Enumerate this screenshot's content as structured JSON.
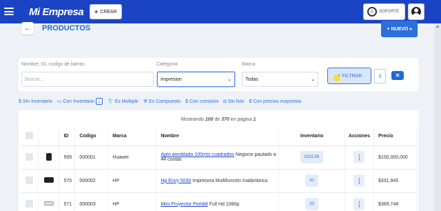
{
  "topbar": {
    "logo": "Mi Empresa",
    "crear_label": "CREAR",
    "soporte_label": "SOPORTE",
    "colors": {
      "bar": "#1a44c4",
      "accent": "#2a6fdb"
    }
  },
  "page": {
    "title": "PRODUCTOS",
    "nuevo_label": "NUEVO"
  },
  "filters": {
    "search_label": "Nombre, ID, codigo de barras",
    "search_placeholder": "Buscar...",
    "categoria_label": "Categoria",
    "categoria_value": "Impresion",
    "marca_label": "Marca",
    "marca_value": "Todas",
    "filtrar_label": "FILTRAR"
  },
  "chips": [
    {
      "icon": "dollar-icon",
      "label": "Sin Inventario"
    },
    {
      "icon": "box-icon",
      "label": "Con Inventario"
    },
    {
      "icon": "shirt-icon",
      "label": "Es Multiple"
    },
    {
      "icon": "shirts-icon",
      "label": "Es Compuesto"
    },
    {
      "icon": "dollar-icon",
      "label": "Con comisión"
    },
    {
      "icon": "camera-icon",
      "label": "Sin foto"
    },
    {
      "icon": "dollar-icon",
      "label": "Con precios mayorista"
    }
  ],
  "table": {
    "showing_prefix": "Mostrando",
    "showing_count": "100",
    "showing_of": "de",
    "showing_total": "370",
    "showing_page_text": "en página",
    "showing_page": "1",
    "headers": [
      "ID",
      "Codigo",
      "Marca",
      "Nombre",
      "Inventario",
      "Acciones",
      "Precio"
    ],
    "rows": [
      {
        "id": "569",
        "codigo": "000001",
        "marca": "Huawei",
        "nombre_link": "Apto amoblado 100mts cuadrados",
        "nombre_rest": "Negocio pautado a 44 cuotas",
        "inventario": "9115.99",
        "precio": "$100,000,000",
        "thumb": "watch"
      },
      {
        "id": "570",
        "codigo": "000002",
        "marca": "HP",
        "nombre_link": "Hp Envy 5030",
        "nombre_rest": "Impresora Multifunción Inalámbrica",
        "inventario": "41",
        "precio": "$331,945",
        "thumb": "glasses"
      },
      {
        "id": "571",
        "codigo": "000003",
        "marca": "HP",
        "nombre_link": "Mini Proyector Portátil",
        "nombre_rest": "Full Hd 1080p",
        "inventario": "23",
        "precio": "$369,748",
        "thumb": "projector"
      }
    ]
  }
}
